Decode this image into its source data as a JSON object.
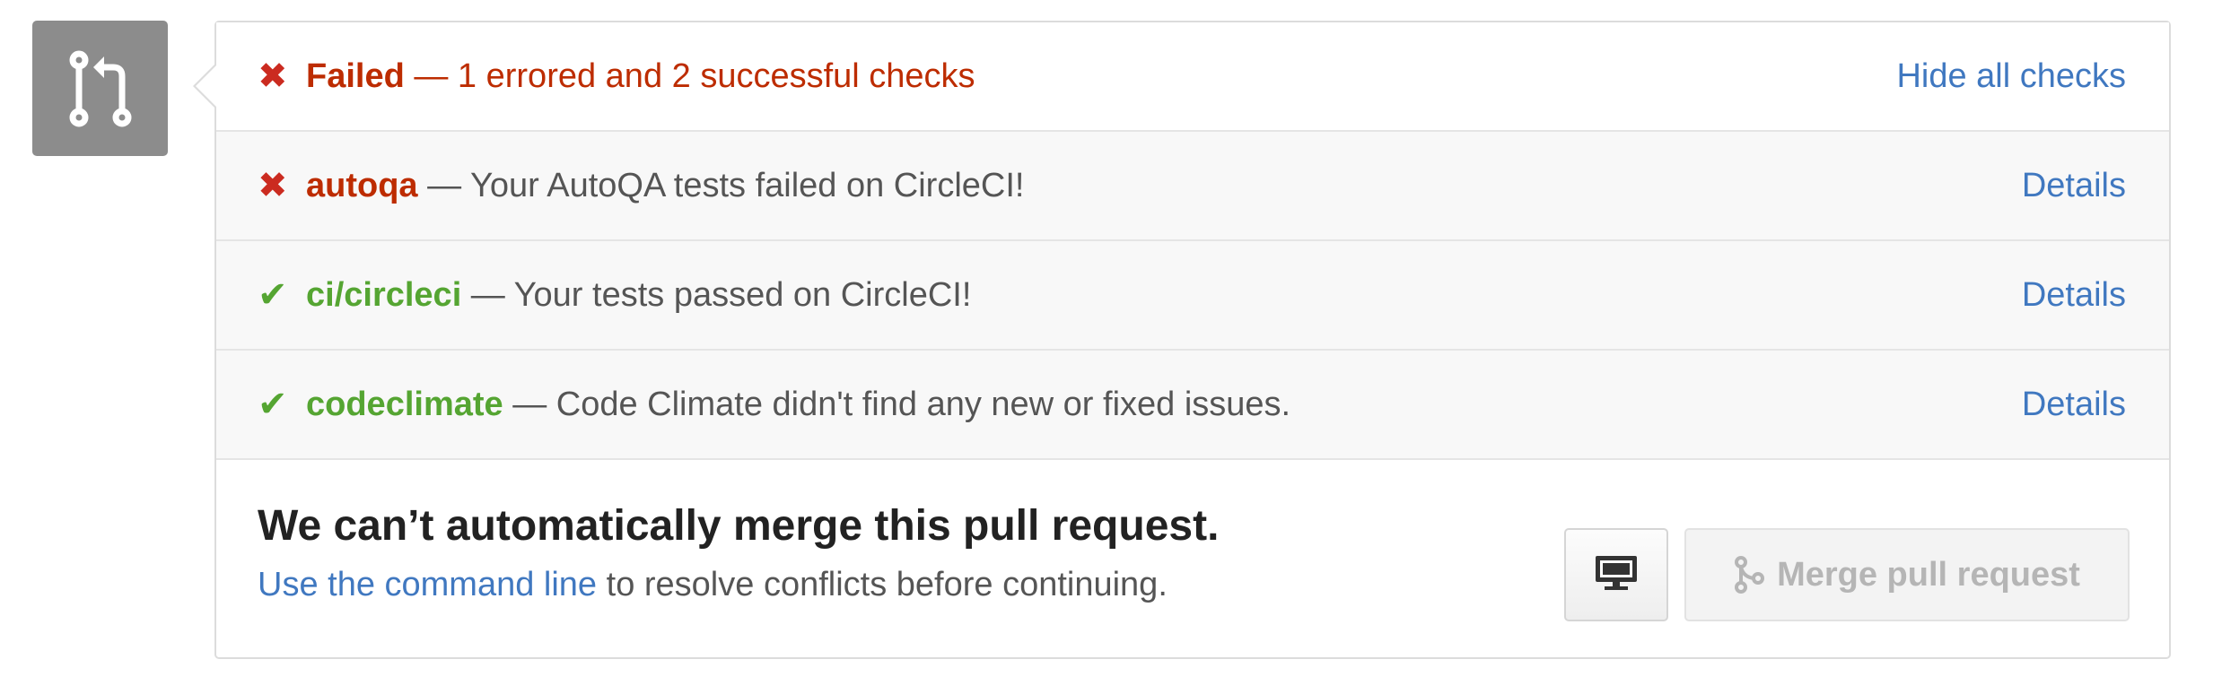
{
  "header": {
    "status_icon": "x-icon",
    "failed_word": "Failed",
    "summary": " — 1 errored and 2 successful checks",
    "toggle_link": "Hide all checks"
  },
  "checks": [
    {
      "state": "error",
      "icon": "x-icon",
      "name": "autoqa",
      "description": " — Your AutoQA tests failed on CircleCI!",
      "details_label": "Details"
    },
    {
      "state": "success",
      "icon": "check-icon",
      "name": "ci/circleci",
      "description": " — Your tests passed on CircleCI!",
      "details_label": "Details"
    },
    {
      "state": "success",
      "icon": "check-icon",
      "name": "codeclimate",
      "description": " — Code Climate didn't find any new or fixed issues.",
      "details_label": "Details"
    }
  ],
  "merge": {
    "title": "We can’t automatically merge this pull request.",
    "command_line_link": "Use the command line",
    "suffix": " to resolve conflicts before continuing.",
    "cli_button_icon": "desktop-icon",
    "merge_button_icon": "git-merge-icon",
    "merge_button_label": "Merge pull request"
  },
  "side_icon": "git-pull-request-icon",
  "colors": {
    "error": "#bd2c00",
    "success": "#55a532",
    "link": "#4078c0",
    "icon_bg": "#8c8c8c"
  }
}
